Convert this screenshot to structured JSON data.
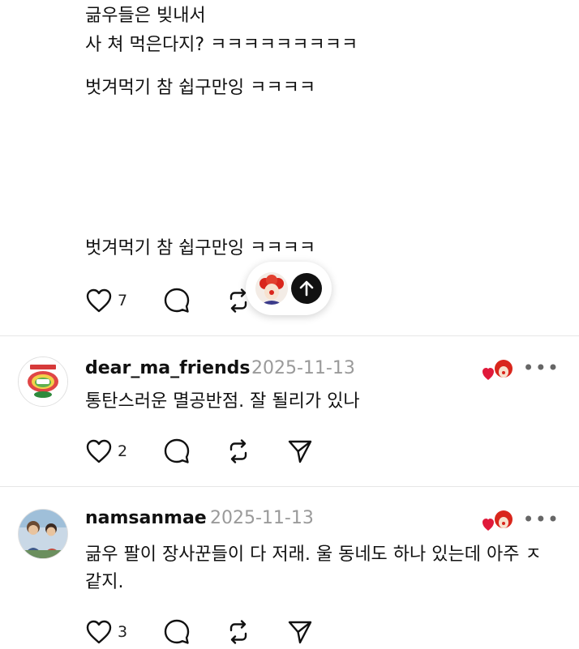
{
  "post": {
    "lines": [
      "긂우들은 빚내서",
      "사 쳐 먹은다지? ㅋㅋㅋㅋㅋㅋㅋㅋㅋ",
      "벗겨먹기 참 쉽구만잉 ㅋㅋㅋㅋ",
      "벗겨먹기 참 쉽구만잉 ㅋㅋㅋㅋ"
    ],
    "like_count": "7"
  },
  "comments": [
    {
      "username": "dear_ma_friends",
      "date": "2025-11-13",
      "text": "통탄스러운 멸공반점. 잘 될리가 있나",
      "like_count": "2",
      "more": "•••"
    },
    {
      "username": "namsanmae",
      "date": "2025-11-13",
      "text": "긂우 팔이 장사꾼들이 다 저래. 울 동네도 하나 있는데 아주 ㅈ 같지.",
      "like_count": "3",
      "more": "•••"
    }
  ],
  "icons": {
    "like": "heart-outline-icon",
    "comment": "speech-bubble-icon",
    "repost": "repost-icon",
    "share": "send-icon",
    "scroll_top": "arrow-up-icon",
    "liked_by_author": "red-heart-icon"
  },
  "colors": {
    "accent_red": "#e0193a",
    "muted_text": "#9a9a9a",
    "divider": "#e6e6e6"
  }
}
